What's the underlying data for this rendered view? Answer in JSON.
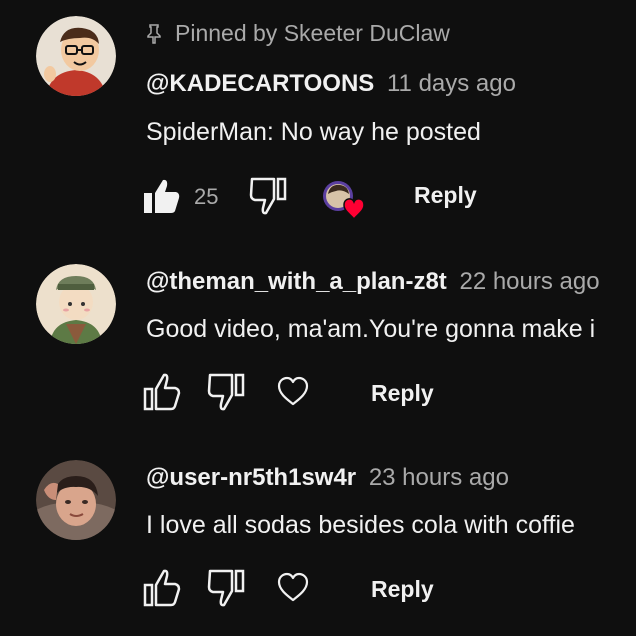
{
  "comments": [
    {
      "pinned_label": "Pinned by Skeeter DuClaw",
      "author": "@KADECARTOONS",
      "time": "11 days ago",
      "text": "SpiderMan: No way he posted",
      "likes": "25",
      "reply_label": "Reply",
      "liked_by_creator": true,
      "icons": [
        "pin-icon",
        "thumb-up-filled-icon",
        "thumb-down-icon",
        "creator-heart-icon"
      ]
    },
    {
      "author": "@theman_with_a_plan-z8t",
      "time": "22 hours ago",
      "text": "Good video, ma'am.You're gonna make i",
      "reply_label": "Reply",
      "icons": [
        "thumb-up-icon",
        "thumb-down-icon",
        "heart-icon"
      ]
    },
    {
      "author": "@user-nr5th1sw4r",
      "time": "23 hours ago",
      "text": "I love all sodas  besides cola with coffie",
      "reply_label": "Reply",
      "icons": [
        "thumb-up-icon",
        "thumb-down-icon",
        "heart-icon"
      ]
    }
  ],
  "colors": {
    "background": "#0f0f0f",
    "primary_text": "#f1f1f1",
    "secondary_text": "#aaaaaa",
    "heart_red": "#ff0033"
  }
}
